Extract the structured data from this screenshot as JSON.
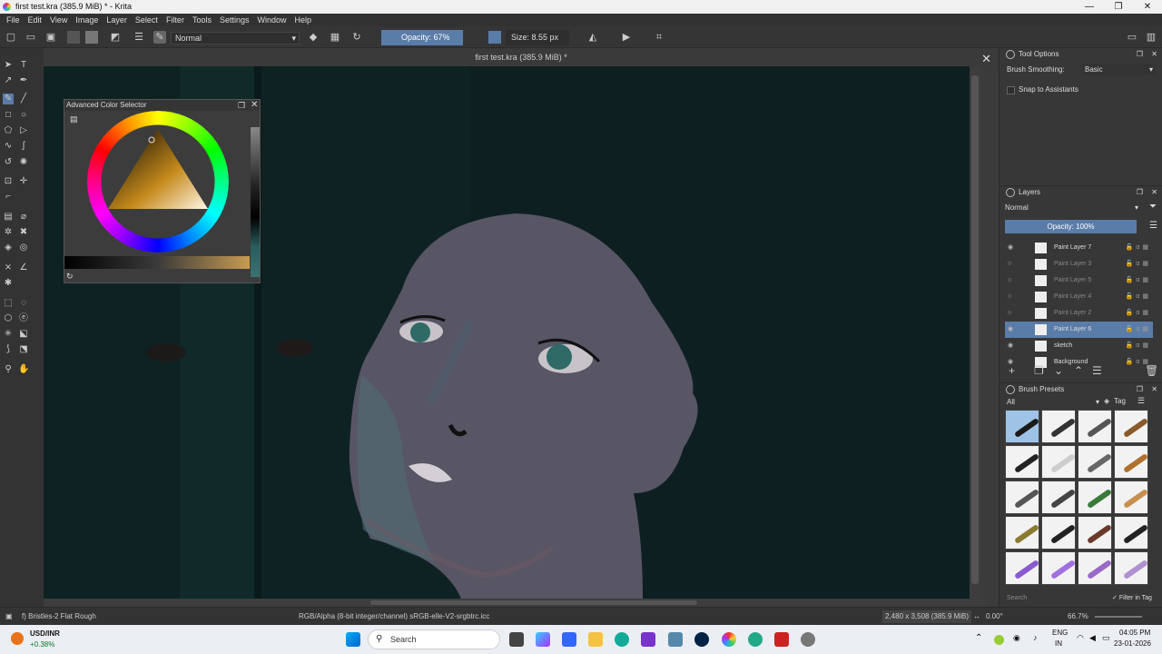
{
  "window": {
    "title": "first test.kra (385.9 MiB) * - Krita",
    "controls": [
      "—",
      "❐",
      "✕"
    ]
  },
  "menu": [
    "File",
    "Edit",
    "View",
    "Image",
    "Layer",
    "Select",
    "Filter",
    "Tools",
    "Settings",
    "Window",
    "Help"
  ],
  "toolbar": {
    "blend_mode": "Normal",
    "opacity": "Opacity: 67%",
    "size": "Size: 8.55 px"
  },
  "document": {
    "title": "first test.kra (385.9 MiB) *"
  },
  "color_selector": {
    "title": "Advanced Color Selector"
  },
  "tool_options": {
    "title": "Tool Options",
    "smoothing_label": "Brush Smoothing:",
    "smoothing_value": "Basic",
    "snap_label": "Snap to Assistants"
  },
  "layers": {
    "title": "Layers",
    "blend": "Normal",
    "opacity": "Opacity:  100%",
    "items": [
      {
        "name": "Paint Layer 7",
        "visible": true,
        "selected": false
      },
      {
        "name": "Paint Layer 3",
        "visible": false,
        "selected": false
      },
      {
        "name": "Paint Layer 5",
        "visible": false,
        "selected": false
      },
      {
        "name": "Paint Layer 4",
        "visible": false,
        "selected": false
      },
      {
        "name": "Paint Layer 2",
        "visible": false,
        "selected": false
      },
      {
        "name": "Paint Layer 6",
        "visible": true,
        "selected": true
      },
      {
        "name": "sketch",
        "visible": true,
        "selected": false
      },
      {
        "name": "Background",
        "visible": true,
        "selected": false
      }
    ]
  },
  "brush_presets": {
    "title": "Brush Presets",
    "filter": "All",
    "tag": "Tag",
    "search_placeholder": "Search",
    "filter_in_tag": "Filter in Tag"
  },
  "status": {
    "brush": "f) Bristles-2 Flat Rough",
    "color_space": "RGB/Alpha (8-bit integer/channel)  sRGB-elle-V2-srgbtrc.icc",
    "dimensions": "2,480 x 3,508 (385.9 MiB)",
    "rotation": "0.00°",
    "zoom": "66.7%"
  },
  "taskbar": {
    "ticker": "USD/INR",
    "change": "+0.38%",
    "search": "Search",
    "lang": "ENG",
    "region": "IN",
    "time": "04:05 PM",
    "date": "23-01-2026"
  }
}
